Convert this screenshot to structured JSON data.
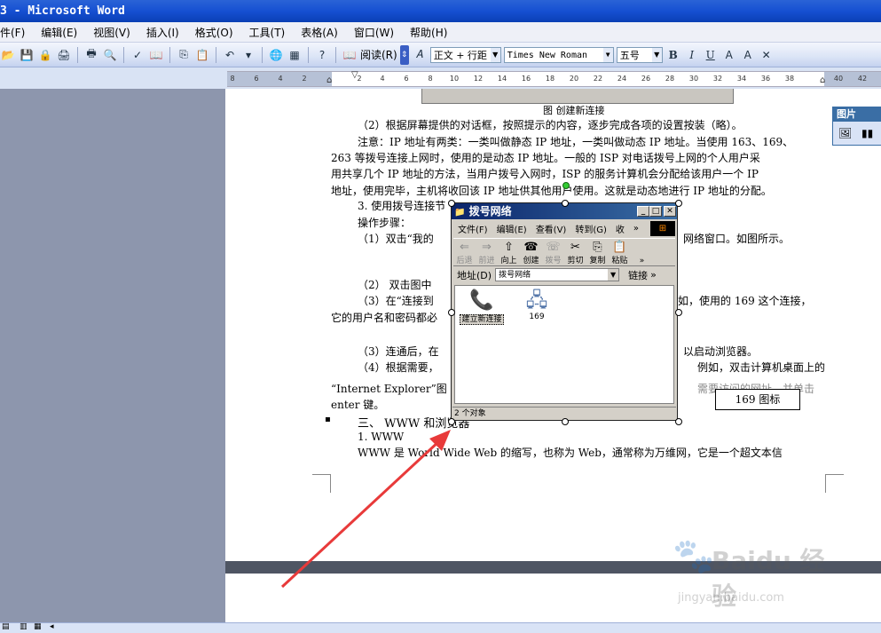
{
  "window": {
    "title": "3 - Microsoft Word"
  },
  "menu": [
    "件(F)",
    "编辑(E)",
    "视图(V)",
    "插入(I)",
    "格式(O)",
    "工具(T)",
    "表格(A)",
    "窗口(W)",
    "帮助(H)"
  ],
  "toolbar": {
    "read_label": "阅读(R)",
    "style": "正文 + 行距",
    "font": "Times New Roman",
    "size": "五号",
    "bold": "B",
    "italic": "I",
    "underline": "U"
  },
  "ruler": {
    "ticks": [
      "8",
      "6",
      "4",
      "2",
      "",
      "2",
      "4",
      "6",
      "8",
      "10",
      "12",
      "14",
      "16",
      "18",
      "20",
      "22",
      "24",
      "26",
      "28",
      "30",
      "32",
      "34",
      "36",
      "38",
      "40",
      "42"
    ]
  },
  "document": {
    "figure_caption": "图  创建新连接",
    "lines": [
      "（2）根据屏幕提供的对话框，按照提示的内容，逐步完成各项的设置按装（略）。",
      "注意：IP 地址有两类：一类叫做静态 IP 地址，一类叫做动态 IP 地址。当使用 163、169、",
      "263 等拨号连接上网时，使用的是动态 IP 地址。一般的 ISP 对电话拨号上网的个人用户采",
      "用共享几个 IP 地址的方法，当用户拨号入网时，ISP 的服务计算机会分配给该用户一个 IP",
      "地址，使用完毕，主机将收回该 IP 地址供其他用户使用。这就是动态地进行 IP 地址的分配。",
      "3. 使用拨号连接节",
      "操作步骤：",
      "（1）双击“我的",
      "网络窗口。如图所示。",
      "（2）  双击图中",
      "（3）在“连接到",
      "如，使用的 169 这个连接，",
      "它的用户名和密码都必",
      "（3）连通后，在",
      "以启动浏览器。",
      "（4）根据需要，",
      "例如，双击计算机桌面上的",
      "“Internet  Explorer”图",
      "需要访问的网址，并单击",
      "enter 键。",
      "三、    WWW 和浏览器",
      "1. WWW",
      "WWW 是 World Wide Web 的缩写，也称为 Web，通常称为万维网，它是一个超文本信"
    ]
  },
  "dialog": {
    "title": "拨号网络",
    "menu": [
      "文件(F)",
      "编辑(E)",
      "查看(V)",
      "转到(G)",
      "收"
    ],
    "tools": [
      {
        "icon": "back-icon",
        "label": "后退",
        "disabled": true
      },
      {
        "icon": "forward-icon",
        "label": "前进",
        "disabled": true
      },
      {
        "icon": "up-icon",
        "label": "向上",
        "disabled": false
      },
      {
        "icon": "create-icon",
        "label": "创建",
        "disabled": false
      },
      {
        "icon": "dial-icon",
        "label": "拨号",
        "disabled": true
      },
      {
        "icon": "cut-icon",
        "label": "剪切",
        "disabled": false
      },
      {
        "icon": "copy-icon",
        "label": "复制",
        "disabled": false
      },
      {
        "icon": "paste-icon",
        "label": "粘贴",
        "disabled": false
      }
    ],
    "address_label": "地址(D)",
    "address_value": "拨号网络",
    "links_label": "链接",
    "items": [
      "建立新连接",
      "169"
    ],
    "status": "2 个对象"
  },
  "picture_toolbar": {
    "title": "图片"
  },
  "callout": {
    "text": "169 图标"
  },
  "watermark": {
    "text": "Baidu 经验",
    "url": "jingyan.baidu.com"
  },
  "colors": {
    "arrow": "#e83a3a",
    "titlebar": "#1650d2"
  }
}
